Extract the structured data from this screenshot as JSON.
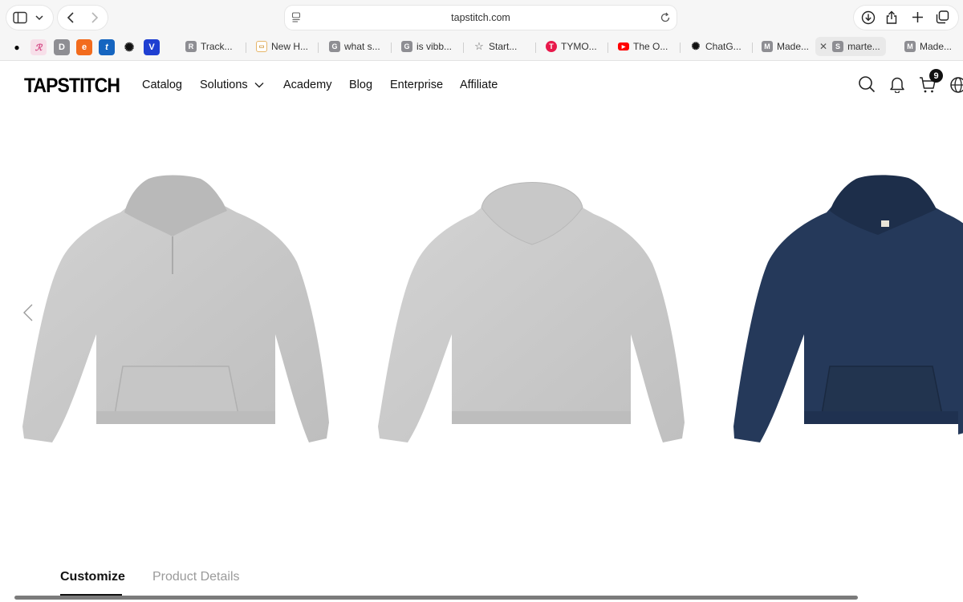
{
  "browser": {
    "url": "tapstitch.com",
    "tabs": [
      {
        "label": "Track...",
        "fav": "R",
        "color": "#8e8e93"
      },
      {
        "label": "New H...",
        "fav": "",
        "color": "#f0c070"
      },
      {
        "label": "what s...",
        "fav": "G",
        "color": "#8e8e93"
      },
      {
        "label": "is vibb...",
        "fav": "G",
        "color": "#8e8e93"
      },
      {
        "label": "Start...",
        "fav": "☆",
        "color": "transparent"
      },
      {
        "label": "TYMO...",
        "fav": "T",
        "color": "#e8194b"
      },
      {
        "label": "The O...",
        "fav": "▶",
        "color": "#ff0000"
      },
      {
        "label": "ChatG...",
        "fav": "✺",
        "color": "transparent"
      },
      {
        "label": "Made...",
        "fav": "M",
        "color": "#8e8e93"
      },
      {
        "label": "marte...",
        "fav": "S",
        "color": "#8e8e93"
      },
      {
        "label": "Made...",
        "fav": "M",
        "color": "#8e8e93"
      }
    ],
    "pinned": [
      {
        "name": "pinned-tab-shirt",
        "glyph": "👕",
        "color": "transparent"
      },
      {
        "name": "pinned-tab-pink",
        "glyph": "ℛ",
        "color": "transparent"
      },
      {
        "name": "pinned-tab-d",
        "glyph": "D",
        "color": "#8e8e93"
      },
      {
        "name": "pinned-tab-e",
        "glyph": "e",
        "color": "#f26b1d"
      },
      {
        "name": "pinned-tab-t",
        "glyph": "t",
        "color": "#1565c0"
      },
      {
        "name": "pinned-tab-openai",
        "glyph": "✺",
        "color": "transparent"
      },
      {
        "name": "pinned-tab-v",
        "glyph": "V",
        "color": "#1f3fd1"
      }
    ]
  },
  "site": {
    "logo": "TAPSTITCH",
    "nav": [
      "Catalog",
      "Solutions",
      "Academy",
      "Blog",
      "Enterprise",
      "Affiliate"
    ],
    "cart_count": "9"
  },
  "gallery": {
    "products": [
      {
        "name": "hoodie-front-grey",
        "color": "#c9c9c9"
      },
      {
        "name": "hoodie-back-grey",
        "color": "#cbcbcb"
      },
      {
        "name": "hoodie-front-navy",
        "color": "#25395a"
      }
    ]
  },
  "detail_tabs": {
    "customize": "Customize",
    "product_details": "Product Details"
  }
}
